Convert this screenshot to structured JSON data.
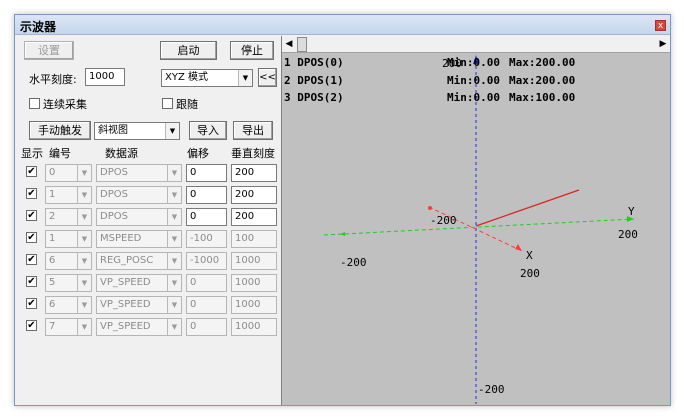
{
  "window": {
    "title": "示波器",
    "close_symbol": "x"
  },
  "controls": {
    "settings_label": "设置",
    "start_label": "启动",
    "stop_label": "停止",
    "h_scale_label": "水平刻度:",
    "h_scale_value": "1000",
    "mode_value": "XYZ 模式",
    "collapse_label": "<<",
    "continuous_label": "连续采集",
    "follow_label": "跟随",
    "manual_trigger_label": "手动触发",
    "view_value": "斜视图",
    "import_label": "导入",
    "export_label": "导出"
  },
  "table": {
    "headers": {
      "show": "显示",
      "num": "编号",
      "source": "数据源",
      "offset": "偏移",
      "scale": "垂直刻度"
    },
    "rows": [
      {
        "num": "0",
        "source": "DPOS",
        "offset": "0",
        "scale": "200",
        "checked": "✔"
      },
      {
        "num": "1",
        "source": "DPOS",
        "offset": "0",
        "scale": "200",
        "checked": "✔"
      },
      {
        "num": "2",
        "source": "DPOS",
        "offset": "0",
        "scale": "200",
        "checked": "✔"
      },
      {
        "num": "1",
        "source": "MSPEED",
        "offset": "-100",
        "scale": "100",
        "checked": "✔"
      },
      {
        "num": "6",
        "source": "REG_POSC",
        "offset": "-1000",
        "scale": "1000",
        "checked": "✔"
      },
      {
        "num": "5",
        "source": "VP_SPEED",
        "offset": "0",
        "scale": "1000",
        "checked": "✔"
      },
      {
        "num": "6",
        "source": "VP_SPEED",
        "offset": "0",
        "scale": "1000",
        "checked": "✔"
      },
      {
        "num": "7",
        "source": "VP_SPEED",
        "offset": "0",
        "scale": "1000",
        "checked": "✔"
      }
    ]
  },
  "plot": {
    "legend": [
      {
        "name": "1 DPOS(0)",
        "min": "Min:0.00",
        "max": "Max:200.00"
      },
      {
        "name": "2 DPOS(1)",
        "min": "Min:0.00",
        "max": "Max:200.00"
      },
      {
        "name": "3 DPOS(2)",
        "min": "Min:0.00",
        "max": "Max:100.00"
      }
    ],
    "axis_labels": {
      "x_axis": "X",
      "y_axis": "Y",
      "z_top": "200",
      "y_pos": "200",
      "y_neg": "-200",
      "x_pos": "200",
      "x_neg": "-200",
      "z_neg": "-200"
    },
    "colors": {
      "x_axis": "#ff3b3b",
      "y_axis": "#22dd22",
      "z_axis": "#2222ee",
      "trace": "#dd2222"
    }
  }
}
